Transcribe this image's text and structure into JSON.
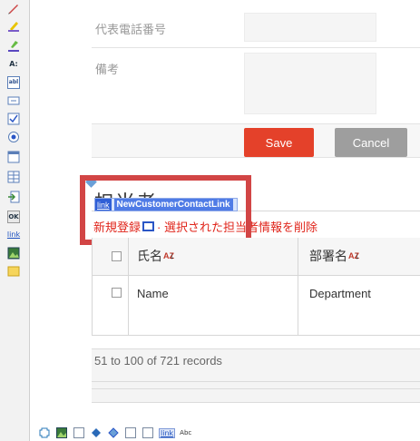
{
  "toolbox": {
    "items": [
      "pen-icon",
      "highlighter-icon",
      "brush-icon",
      "text-format-icon",
      "textbox-icon",
      "input-field-icon",
      "checkbox-icon",
      "radio-icon",
      "window-icon",
      "table-icon",
      "import-icon",
      "ok-button-icon",
      "link-icon",
      "image-icon",
      "note-icon"
    ],
    "text_format_label": "A:",
    "textbox_label": "abl",
    "ok_label": "OK",
    "link_label": "link"
  },
  "form": {
    "phone_label": "代表電話番号",
    "notes_label": "備考",
    "save_label": "Save",
    "cancel_label": "Cancel"
  },
  "contacts": {
    "section_title": "担当者",
    "link_badge": "link",
    "link_name": "NewCustomerContactLink",
    "new_register": "新規登録",
    "delete_selected": "· 選択された担当者情報を削除",
    "columns": [
      "氏名",
      "部署名"
    ],
    "sort_indicator": "AZ",
    "rows": [
      {
        "name": "Name",
        "department": "Department"
      }
    ],
    "records_text": "51 to 100 of 721 records"
  },
  "palette": {
    "link_label": "link",
    "abc_label": "Abc"
  },
  "colors": {
    "save": "#e4412a",
    "cancel": "#9e9e9e",
    "selection_frame": "#d24545",
    "link_blue": "#2f5fd6",
    "delete_text": "#e0251b"
  }
}
